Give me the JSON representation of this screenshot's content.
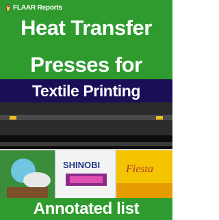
{
  "cover": {
    "brand": "FLAAR Reports",
    "title_line1": "Heat Transfer",
    "title_line2": "Presses for",
    "subtitle": "Textile Printing",
    "footer": "Annotated list"
  },
  "colors": {
    "green": "#2f9b2e",
    "navy": "#1c0d57",
    "text": "#ffffff"
  },
  "photo": {
    "banner_text_1": "SHINOBI",
    "banner_text_2": "Fiesta"
  }
}
